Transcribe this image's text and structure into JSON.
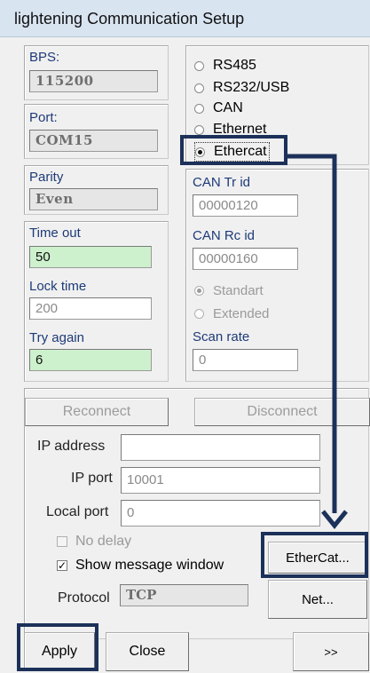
{
  "window": {
    "title": "lightening Communication Setup"
  },
  "serial": {
    "bps_label": "BPS:",
    "bps_value": "115200",
    "port_label": "Port:",
    "port_value": "COM15",
    "parity_label": "Parity",
    "parity_value": "Even"
  },
  "timing": {
    "timeout_label": "Time out",
    "timeout_value": "50",
    "locktime_label": "Lock time",
    "locktime_value": "200",
    "tryagain_label": "Try again",
    "tryagain_value": "6"
  },
  "interface": {
    "options": [
      {
        "label": "RS485",
        "selected": false
      },
      {
        "label": "RS232/USB",
        "selected": false
      },
      {
        "label": "CAN",
        "selected": false
      },
      {
        "label": "Ethernet",
        "selected": false
      },
      {
        "label": "Ethercat",
        "selected": true
      }
    ]
  },
  "can": {
    "tr_label": "CAN Tr id",
    "tr_value": "00000120",
    "rc_label": "CAN Rc id",
    "rc_value": "00000160",
    "frame_options": [
      {
        "label": "Standart",
        "selected": true
      },
      {
        "label": "Extended",
        "selected": false
      }
    ],
    "scan_label": "Scan rate",
    "scan_value": "0"
  },
  "network": {
    "reconnect_label": "Reconnect",
    "disconnect_label": "Disconnect",
    "ip_address_label": "IP address",
    "ip_address_value": "",
    "ip_port_label": "IP port",
    "ip_port_value": "10001",
    "local_port_label": "Local port",
    "local_port_value": "0",
    "no_delay_label": "No delay",
    "no_delay_checked": false,
    "show_msg_label": "Show message window",
    "show_msg_checked": true,
    "protocol_label": "Protocol",
    "protocol_value": "TCP",
    "ethercat_button": "EtherCat...",
    "net_button": "Net..."
  },
  "footer": {
    "apply_label": "Apply",
    "close_label": "Close",
    "more_label": ">>"
  },
  "colors": {
    "highlight": "#1c3159",
    "green_field": "#cdf1cd",
    "title_bar": "#d9e4f1"
  }
}
